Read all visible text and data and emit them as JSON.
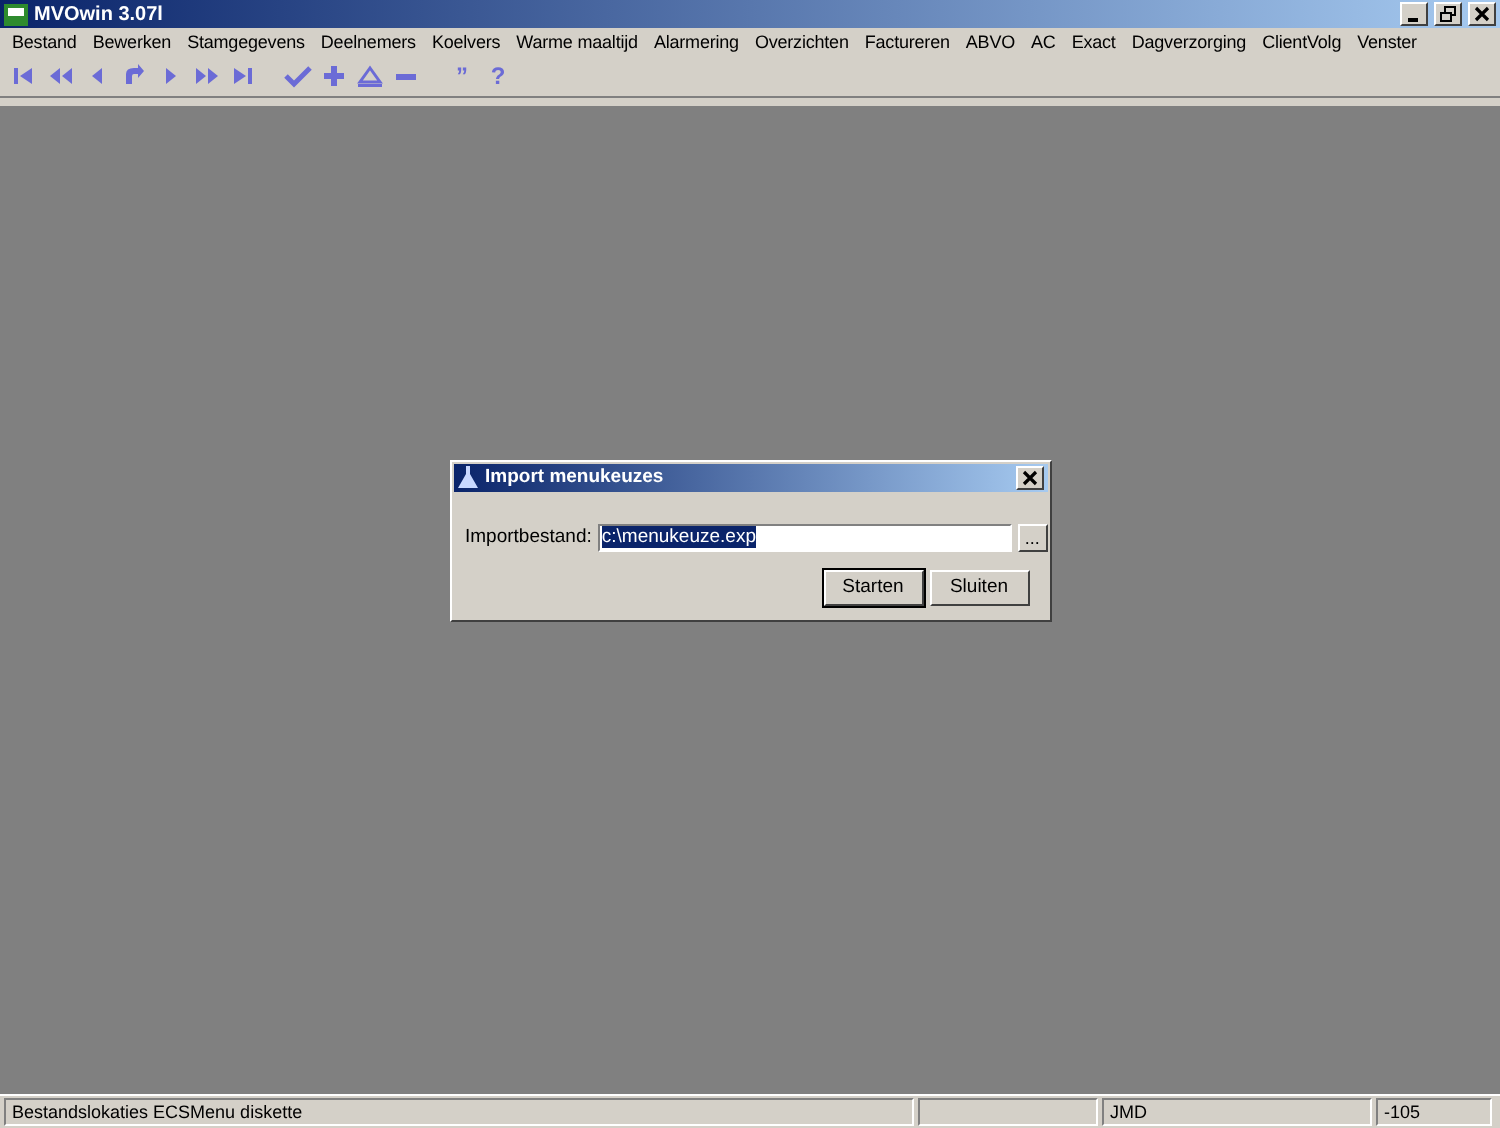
{
  "window": {
    "title": "MVOwin 3.07l"
  },
  "menu": [
    "Bestand",
    "Bewerken",
    "Stamgegevens",
    "Deelnemers",
    "Koelvers",
    "Warme maaltijd",
    "Alarmering",
    "Overzichten",
    "Factureren",
    "ABVO",
    "AC",
    "Exact",
    "Dagverzorging",
    "ClientVolg",
    "Venster"
  ],
  "toolbar": {
    "glyphs": [
      "”",
      "?"
    ]
  },
  "dialog": {
    "title": "Import menukeuzes",
    "field_label": "Importbestand:",
    "field_value": "c:\\menukeuze.exp",
    "value_selected": true,
    "browse_button": "...",
    "buttons": [
      {
        "label": "Starten",
        "default": true
      },
      {
        "label": "Sluiten",
        "default": false
      }
    ]
  },
  "status_bar": [
    "Bestandslokaties ECSMenu diskette",
    "JMD",
    "-105"
  ]
}
